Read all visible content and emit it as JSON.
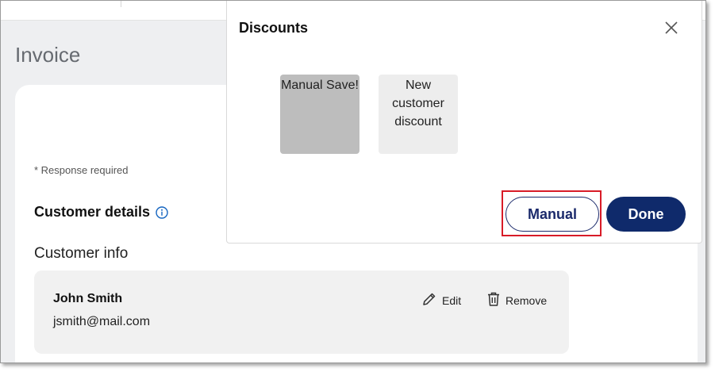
{
  "page": {
    "title": "Invoice",
    "response_required": "* Response required",
    "customer_details_heading": "Customer details",
    "customer_info_heading": "Customer info",
    "customer": {
      "name": "John Smith",
      "email": "jsmith@mail.com",
      "edit_label": "Edit",
      "remove_label": "Remove"
    }
  },
  "modal": {
    "title": "Discounts",
    "discounts": [
      {
        "label": "Manual Save!",
        "selected": true
      },
      {
        "label": "New customer discount",
        "selected": false
      }
    ],
    "manual_label": "Manual",
    "done_label": "Done"
  },
  "icons": {
    "info": "info-icon",
    "edit": "pencil-icon",
    "remove": "trash-icon",
    "close": "close-icon"
  },
  "colors": {
    "primary": "#0f2a6b",
    "highlight": "#d81b27",
    "info_icon": "#1565c0"
  }
}
